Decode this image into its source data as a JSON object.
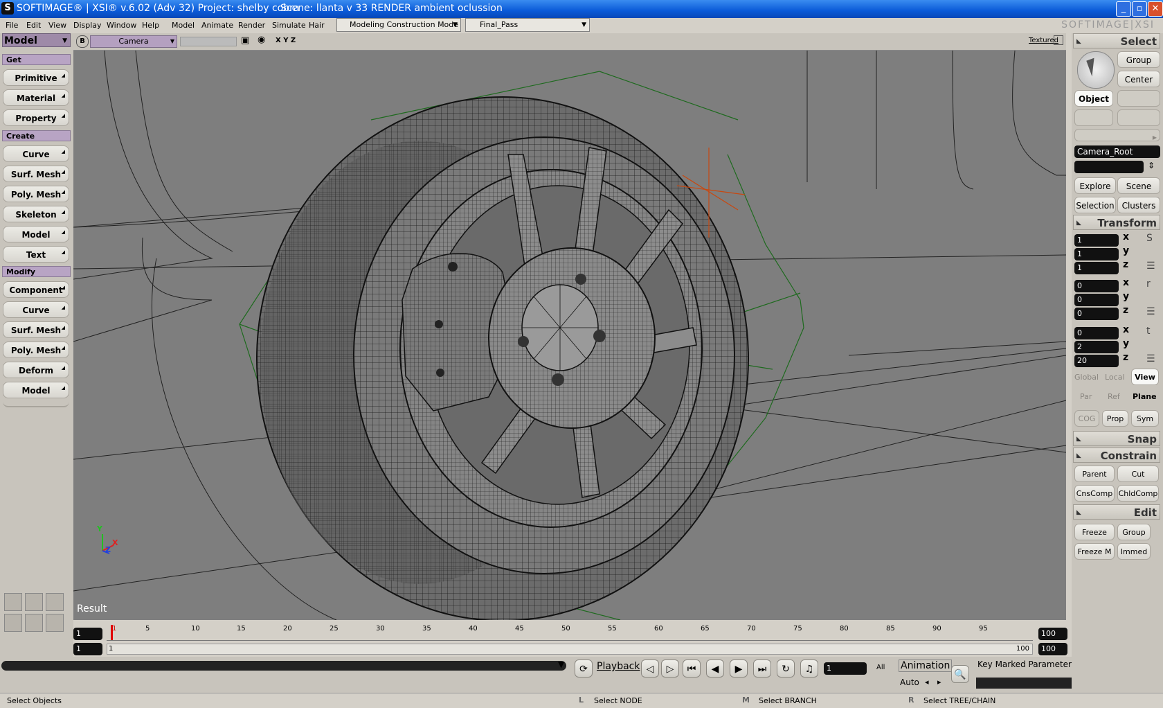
{
  "window": {
    "title": "SOFTIMAGE® | XSI® v.6.02 (Adv 32) Project: shelby cobra",
    "scene": "Scene: llanta v 33 RENDER ambient oclussion",
    "logo_letter": "S",
    "brand": "SOFTIMAGE|XSI"
  },
  "menu": [
    "File",
    "Edit",
    "View",
    "Display",
    "Window",
    "Help",
    "Model",
    "Animate",
    "Render",
    "Simulate",
    "Hair"
  ],
  "mode_combo": "Modeling Construction Mode",
  "pass_combo": "Final_Pass",
  "left": {
    "module": "Model",
    "get_header": "Get",
    "get_items": [
      "Primitive",
      "Material",
      "Property"
    ],
    "create_header": "Create",
    "create_items": [
      "Curve",
      "Surf. Mesh",
      "Poly. Mesh",
      "Skeleton",
      "Model",
      "Text"
    ],
    "modify_header": "Modify",
    "modify_items": [
      "Component",
      "Curve",
      "Surf. Mesh",
      "Poly. Mesh",
      "Deform",
      "Model"
    ]
  },
  "viewport": {
    "letter": "B",
    "camera": "Camera",
    "axes": "X Y Z",
    "display_mode": "Textured",
    "result_label": "Result",
    "axis_y": "Y",
    "axis_x": "X",
    "axis_z": "Z"
  },
  "timeline": {
    "start_field": "1",
    "range_start": "1",
    "range_start_label": "1",
    "range_end_label": "100",
    "end_field": "100",
    "end_field2": "100",
    "ticks": [
      "1",
      "5",
      "10",
      "15",
      "20",
      "25",
      "30",
      "35",
      "40",
      "45",
      "50",
      "55",
      "60",
      "65",
      "70",
      "75",
      "80",
      "85",
      "90",
      "95"
    ]
  },
  "playback": {
    "playback_label": "Playback",
    "frame_field": "1",
    "all_label": "All",
    "animation_label": "Animation",
    "auto_label": "Auto",
    "key_label": "Key Marked Parameters"
  },
  "status": {
    "message": "Select Objects",
    "l_key": "L",
    "l_text": "Select NODE",
    "m_key": "M",
    "m_text": "Select BRANCH",
    "r_key": "R",
    "r_text": "Select TREE/CHAIN"
  },
  "right": {
    "select_header": "Select",
    "group_btn": "Group",
    "center_btn": "Center",
    "object_btn": "Object",
    "name_field": "Camera_Root",
    "explore_btn": "Explore",
    "scene_btn": "Scene",
    "selection_btn": "Selection",
    "clusters_btn": "Clusters",
    "transform_header": "Transform",
    "scale": [
      "1",
      "1",
      "1"
    ],
    "rotate": [
      "0",
      "0",
      "0"
    ],
    "translate": [
      "0",
      "2",
      "20"
    ],
    "axis_labels": [
      "x",
      "y",
      "z"
    ],
    "scale_icon": "S",
    "rotate_icon": "r",
    "translate_icon": "t",
    "global_btn": "Global",
    "local_btn": "Local",
    "view_btn": "View",
    "par_btn": "Par",
    "ref_btn": "Ref",
    "plane_btn": "Plane",
    "cog_btn": "COG",
    "prop_btn": "Prop",
    "sym_btn": "Sym",
    "snap_header": "Snap",
    "constrain_header": "Constrain",
    "parent_btn": "Parent",
    "cut_btn": "Cut",
    "cnscomp_btn": "CnsComp",
    "chldcomp_btn": "ChldComp",
    "edit_header": "Edit",
    "freeze_btn": "Freeze",
    "group2_btn": "Group",
    "freezem_btn": "Freeze M",
    "immed_btn": "Immed"
  }
}
